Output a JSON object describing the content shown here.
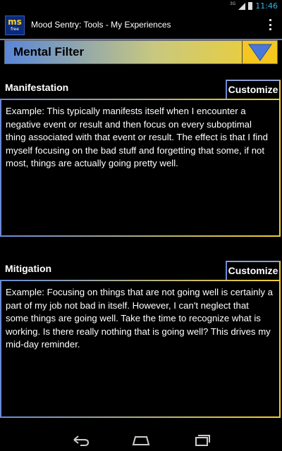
{
  "statusbar": {
    "network": "3G",
    "time": "11:46"
  },
  "actionbar": {
    "logo_line1": "ms",
    "logo_line2": "free",
    "title": "Mood Sentry: Tools - My Experiences"
  },
  "spinner": {
    "selected": "Mental Filter"
  },
  "manifestation": {
    "label": "Manifestation",
    "customize_label": "Customize",
    "text": "Example: This typically manifests itself when I encounter a negative event or result and then focus on every suboptimal thing associated with that event or result.  The effect is that I find myself focusing on the bad stuff and forgetting that some, if not most, things are actually going pretty well."
  },
  "mitigation": {
    "label": "Mitigation",
    "customize_label": "Customize",
    "text": "Example: Focusing on things that are not going well is certainly a part of my job not bad in itself.  However, I can't neglect that some things are going well.  Take the time to recognize what is working.  Is there really nothing that is going well?  This drives my mid-day reminder."
  },
  "colors": {
    "accent_blue": "#5a86d8",
    "accent_yellow": "#f2cf2a",
    "status_blue": "#33b5e5"
  },
  "icons": [
    "signal-icon",
    "battery-icon",
    "overflow-menu-icon",
    "dropdown-arrow-icon",
    "back-icon",
    "home-icon",
    "recent-apps-icon"
  ]
}
